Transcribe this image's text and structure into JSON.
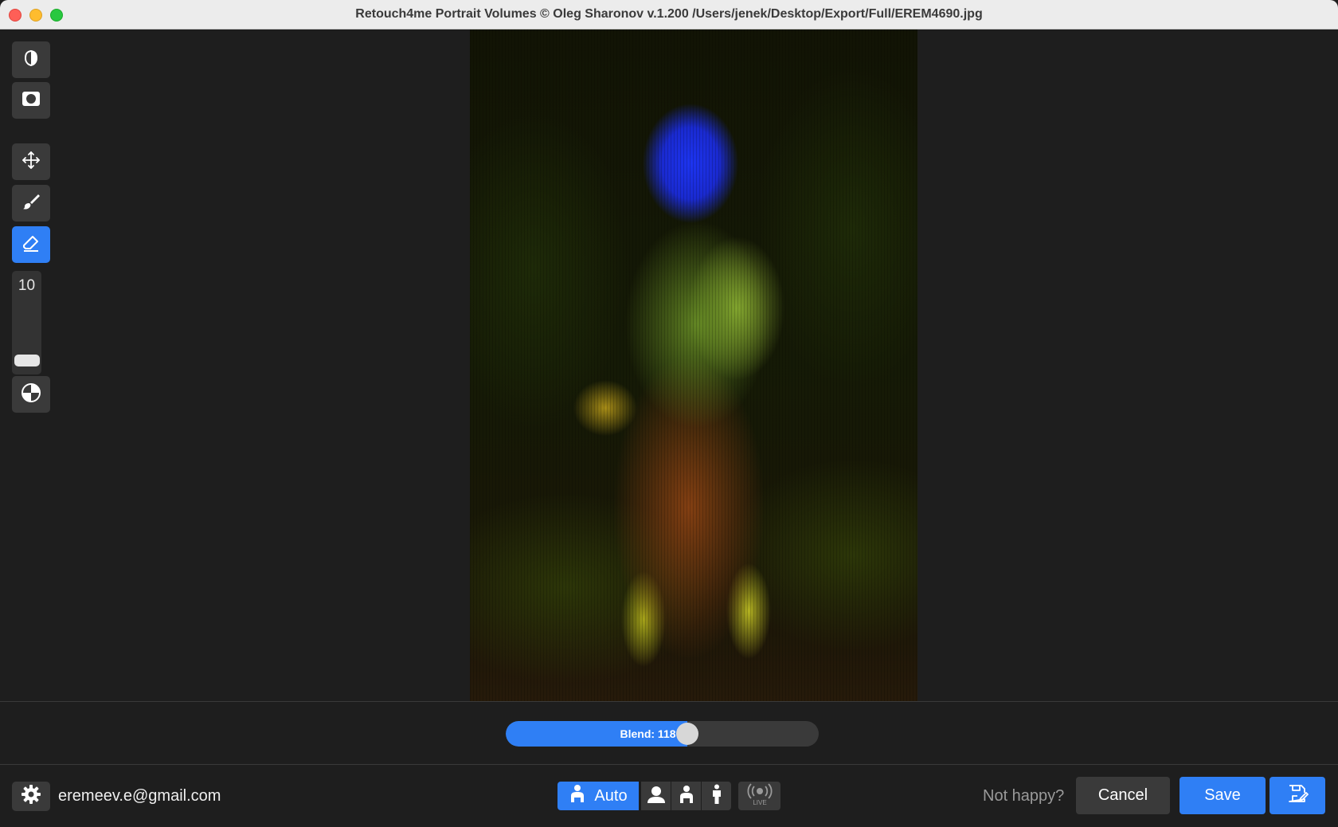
{
  "window": {
    "title": "Retouch4me Portrait Volumes © Oleg Sharonov v.1.200 /Users/jenek/Desktop/Export/Full/EREM4690.jpg"
  },
  "tools": [
    {
      "name": "volume-mask-tool",
      "icon": "half-shield-icon",
      "active": false
    },
    {
      "name": "frame-tool",
      "icon": "frame-icon",
      "active": false
    },
    {
      "name": "move-tool",
      "icon": "move-arrows-icon",
      "active": false
    },
    {
      "name": "brush-tool",
      "icon": "brush-icon",
      "active": false
    },
    {
      "name": "eraser-tool",
      "icon": "eraser-icon",
      "active": true
    },
    {
      "name": "compare-tool",
      "icon": "contrast-circle-icon",
      "active": false
    }
  ],
  "brush": {
    "size": "10",
    "level": 0.1
  },
  "blend": {
    "label": "Blend: 118",
    "fraction": 0.58
  },
  "footer": {
    "email": "eremeev.e@gmail.com",
    "mode_auto_label": "Auto",
    "not_happy": "Not happy?",
    "cancel_label": "Cancel",
    "save_label": "Save",
    "live_icon": "live-broadcast-icon"
  },
  "colors": {
    "accent": "#2f7ff5",
    "button": "#3a3a3a",
    "background": "#1e1e1e"
  }
}
